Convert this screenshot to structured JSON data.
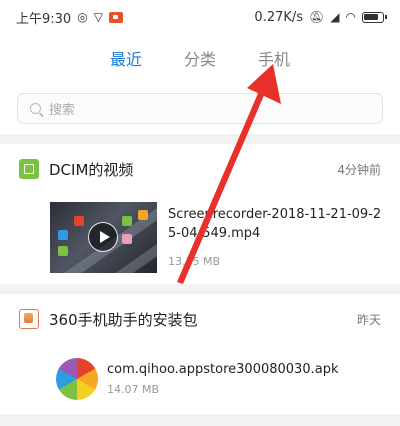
{
  "status_bar": {
    "time": "上午9:30",
    "net_speed": "0.27K/s"
  },
  "tabs": [
    {
      "label": "最近",
      "active": true
    },
    {
      "label": "分类",
      "active": false
    },
    {
      "label": "手机",
      "active": false
    }
  ],
  "search": {
    "placeholder": "搜索"
  },
  "groups": [
    {
      "title": "DCIM的视频",
      "time": "4分钟前",
      "files": [
        {
          "name": "Screenrecorder-2018-11-21-09-25-04-549.mp4",
          "size": "13.35 MB"
        }
      ]
    },
    {
      "title": "360手机助手的安装包",
      "time": "昨天",
      "files": [
        {
          "name": "com.qihoo.appstore300080030.apk",
          "size": "14.07 MB"
        }
      ]
    }
  ],
  "colors": {
    "accent": "#1e7bd8",
    "arrow": "#e8312b"
  }
}
